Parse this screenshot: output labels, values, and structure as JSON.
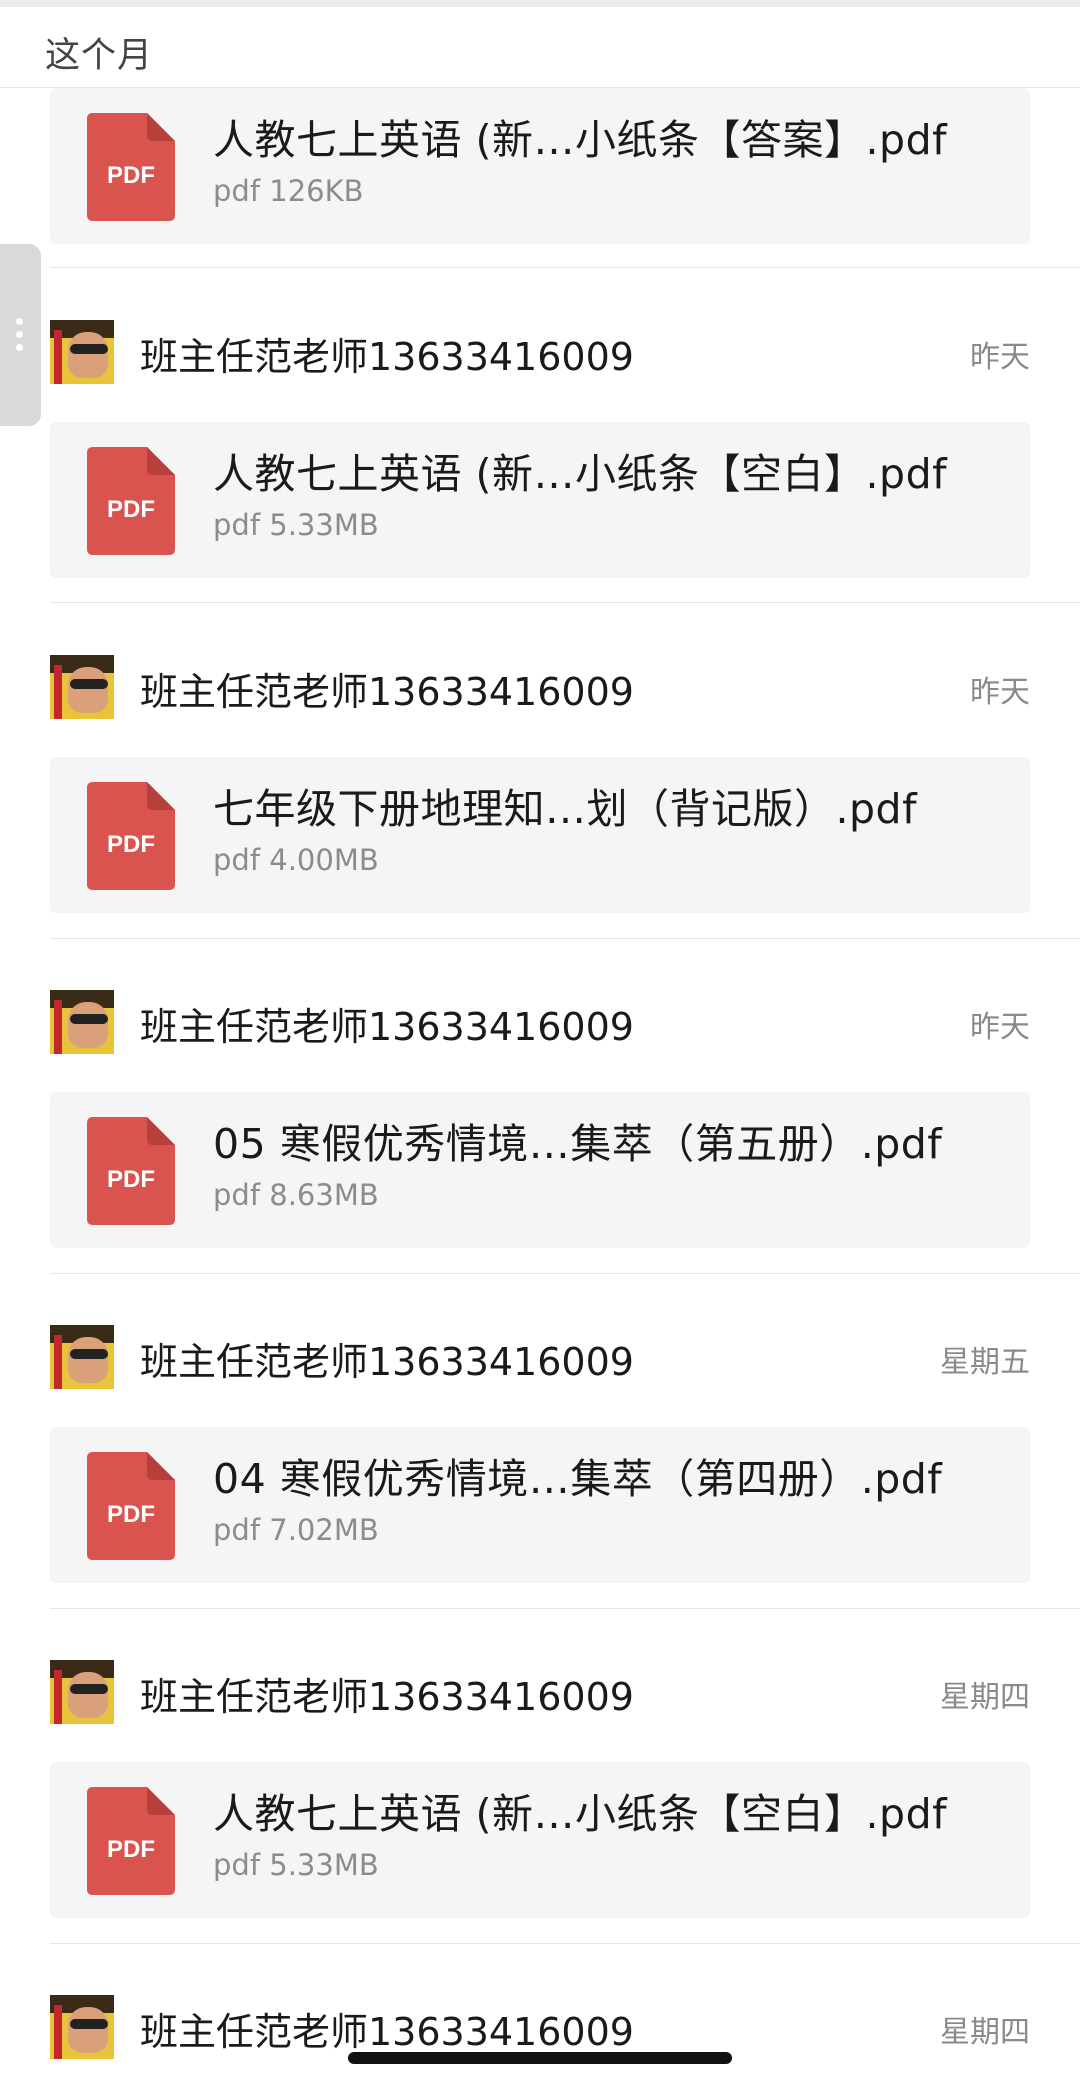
{
  "section": {
    "title": "这个月"
  },
  "colors": {
    "pdf_red": "#d9534f",
    "card_bg": "#f5f5f5",
    "meta_gray": "#8c8c8c"
  },
  "pdf_icon": {
    "label": "PDF",
    "icon": "pdf-file-icon"
  },
  "rows": [
    {
      "sender": "",
      "time": "",
      "file_name": "人教七上英语 (新…小纸条【答案】.pdf",
      "file_meta": "pdf 126KB"
    },
    {
      "sender": "班主任范老师13633416009",
      "time": "昨天",
      "file_name": "人教七上英语 (新…小纸条【空白】.pdf",
      "file_meta": "pdf 5.33MB"
    },
    {
      "sender": "班主任范老师13633416009",
      "time": "昨天",
      "file_name": "七年级下册地理知…划（背记版）.pdf",
      "file_meta": "pdf 4.00MB"
    },
    {
      "sender": "班主任范老师13633416009",
      "time": "昨天",
      "file_name": "05 寒假优秀情境…集萃（第五册）.pdf",
      "file_meta": "pdf 8.63MB"
    },
    {
      "sender": "班主任范老师13633416009",
      "time": "星期五",
      "file_name": "04 寒假优秀情境…集萃（第四册）.pdf",
      "file_meta": "pdf 7.02MB"
    },
    {
      "sender": "班主任范老师13633416009",
      "time": "星期四",
      "file_name": "人教七上英语 (新…小纸条【空白】.pdf",
      "file_meta": "pdf 5.33MB"
    },
    {
      "sender": "班主任范老师13633416009",
      "time": "星期四",
      "file_name": "",
      "file_meta": ""
    }
  ]
}
